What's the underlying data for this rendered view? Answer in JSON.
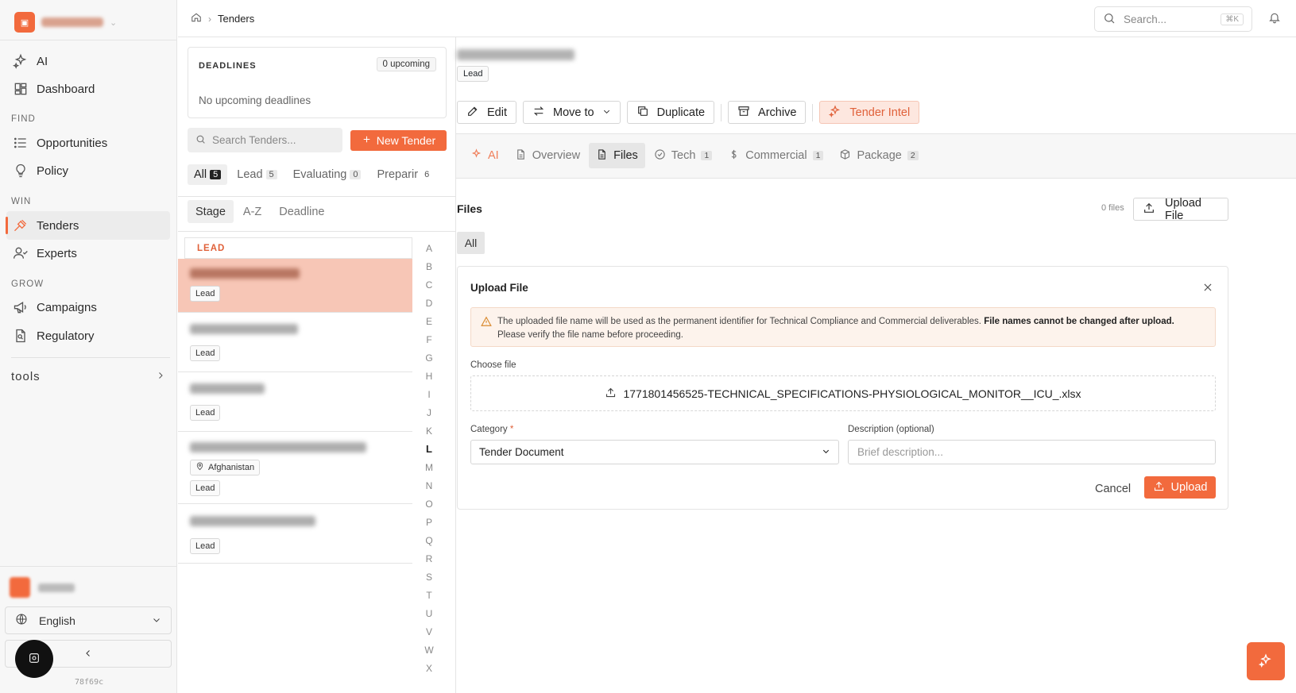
{
  "sidebar": {
    "nav_top": [
      {
        "label": "AI"
      },
      {
        "label": "Dashboard"
      }
    ],
    "sections": {
      "find": "FIND",
      "win": "WIN",
      "grow": "GROW"
    },
    "find_items": [
      {
        "label": "Opportunities"
      },
      {
        "label": "Policy"
      }
    ],
    "win_items": [
      {
        "label": "Tenders"
      },
      {
        "label": "Experts"
      }
    ],
    "grow_items": [
      {
        "label": "Campaigns"
      },
      {
        "label": "Regulatory"
      }
    ],
    "tools_label": "tools",
    "language": "English",
    "version": "78f69c",
    "accent_color": "#f26a3d"
  },
  "topbar": {
    "breadcrumb_current": "Tenders",
    "search_placeholder": "Search...",
    "search_shortcut": "⌘K"
  },
  "list": {
    "deadlines": {
      "title": "DEADLINES",
      "badge": "0 upcoming",
      "empty": "No upcoming deadlines"
    },
    "search_placeholder": "Search Tenders...",
    "new_button": "New Tender",
    "filters": [
      {
        "label": "All",
        "count": "5"
      },
      {
        "label": "Lead",
        "count": "5"
      },
      {
        "label": "Evaluating",
        "count": "0"
      },
      {
        "label": "Preparir",
        "count": "6"
      }
    ],
    "sort_tabs": [
      "Stage",
      "A-Z",
      "Deadline"
    ],
    "group_label": "LEAD",
    "cards": [
      {
        "stage": "Lead",
        "location": ""
      },
      {
        "stage": "Lead",
        "location": ""
      },
      {
        "stage": "Lead",
        "location": ""
      },
      {
        "stage": "Lead",
        "location": "Afghanistan"
      },
      {
        "stage": "Lead",
        "location": ""
      }
    ],
    "alphabet": [
      "A",
      "B",
      "C",
      "D",
      "E",
      "F",
      "G",
      "H",
      "I",
      "J",
      "K",
      "L",
      "M",
      "N",
      "O",
      "P",
      "Q",
      "R",
      "S",
      "T",
      "U",
      "V",
      "W",
      "X"
    ],
    "alphabet_active": "L"
  },
  "detail": {
    "stage_badge": "Lead",
    "actions": {
      "edit": "Edit",
      "move_to": "Move to",
      "duplicate": "Duplicate",
      "archive": "Archive",
      "intel": "Tender Intel"
    },
    "tabs": [
      {
        "label": "AI",
        "count": ""
      },
      {
        "label": "Overview",
        "count": ""
      },
      {
        "label": "Files",
        "count": ""
      },
      {
        "label": "Tech",
        "count": "1"
      },
      {
        "label": "Commercial",
        "count": "1"
      },
      {
        "label": "Package",
        "count": "2"
      }
    ],
    "active_tab": "Files",
    "files": {
      "title": "Files",
      "count_text": "0 files",
      "upload_button": "Upload File",
      "filter_all": "All"
    },
    "upload_dialog": {
      "title": "Upload File",
      "warning_pre": "The uploaded file name will be used as the permanent identifier for Technical Compliance and Commercial deliverables.",
      "warning_bold": "File names cannot be changed after upload.",
      "warning_post": "Please verify the file name before proceeding.",
      "choose_label": "Choose file",
      "file_name": "1771801456525-TECHNICAL_SPECIFICATIONS-PHYSIOLOGICAL_MONITOR__ICU_.xlsx",
      "category_label": "Category",
      "required_mark": "*",
      "category_value": "Tender Document",
      "description_label": "Description (optional)",
      "description_placeholder": "Brief description...",
      "cancel": "Cancel",
      "upload": "Upload"
    }
  }
}
